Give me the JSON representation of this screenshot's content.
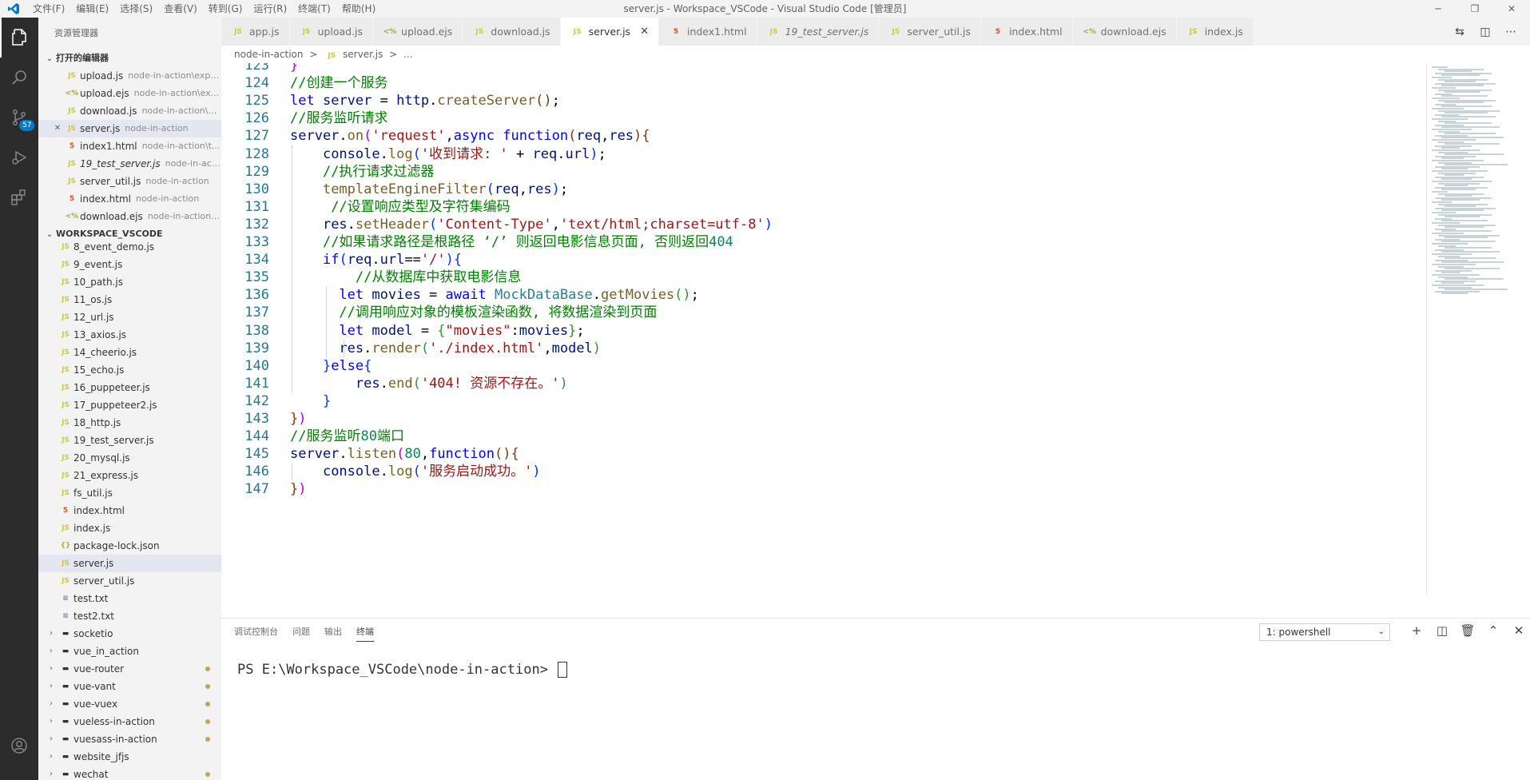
{
  "titlebar": {
    "menu": [
      "文件(F)",
      "编辑(E)",
      "选择(S)",
      "查看(V)",
      "转到(G)",
      "运行(R)",
      "终端(T)",
      "帮助(H)"
    ],
    "title": "server.js - Workspace_VSCode - Visual Studio Code [管理员]"
  },
  "activity": {
    "scm_badge": "57"
  },
  "sidebar": {
    "header": "资源管理器",
    "open_editors_title": "打开的编辑器",
    "open_editors": [
      {
        "icon": "JS",
        "kind": "js",
        "name": "upload.js",
        "desc": "node-in-action\\expr...",
        "close": "",
        "sel": false
      },
      {
        "icon": "<%",
        "kind": "ejs",
        "name": "upload.ejs",
        "desc": "node-in-action\\ex...",
        "close": "",
        "sel": false
      },
      {
        "icon": "JS",
        "kind": "js",
        "name": "download.js",
        "desc": "node-in-action\\e...",
        "close": "",
        "sel": false
      },
      {
        "icon": "JS",
        "kind": "js",
        "name": "server.js",
        "desc": "node-in-action",
        "close": "✕",
        "sel": true
      },
      {
        "icon": "5",
        "kind": "html",
        "name": "index1.html",
        "desc": "node-in-action\\t...",
        "close": "",
        "sel": false
      },
      {
        "icon": "JS",
        "kind": "js",
        "name": "19_test_server.js",
        "desc": "node-in-action",
        "close": "",
        "sel": false
      },
      {
        "icon": "JS",
        "kind": "js",
        "name": "server_util.js",
        "desc": "node-in-action",
        "close": "",
        "sel": false
      },
      {
        "icon": "5",
        "kind": "html",
        "name": "index.html",
        "desc": "node-in-action",
        "close": "",
        "sel": false
      },
      {
        "icon": "<%",
        "kind": "ejs",
        "name": "download.ejs",
        "desc": "node-in-action\\...",
        "close": "",
        "sel": false
      }
    ],
    "workspace_title": "WORKSPACE_VSCODE",
    "files": [
      {
        "icon": "JS",
        "kind": "js",
        "name": "8_event_demo.js"
      },
      {
        "icon": "JS",
        "kind": "js",
        "name": "9_event.js"
      },
      {
        "icon": "JS",
        "kind": "js",
        "name": "10_path.js"
      },
      {
        "icon": "JS",
        "kind": "js",
        "name": "11_os.js"
      },
      {
        "icon": "JS",
        "kind": "js",
        "name": "12_url.js"
      },
      {
        "icon": "JS",
        "kind": "js",
        "name": "13_axios.js"
      },
      {
        "icon": "JS",
        "kind": "js",
        "name": "14_cheerio.js"
      },
      {
        "icon": "JS",
        "kind": "js",
        "name": "15_echo.js"
      },
      {
        "icon": "JS",
        "kind": "js",
        "name": "16_puppeteer.js"
      },
      {
        "icon": "JS",
        "kind": "js",
        "name": "17_puppeteer2.js"
      },
      {
        "icon": "JS",
        "kind": "js",
        "name": "18_http.js"
      },
      {
        "icon": "JS",
        "kind": "js",
        "name": "19_test_server.js"
      },
      {
        "icon": "JS",
        "kind": "js",
        "name": "20_mysql.js"
      },
      {
        "icon": "JS",
        "kind": "js",
        "name": "21_express.js"
      },
      {
        "icon": "JS",
        "kind": "js",
        "name": "fs_util.js"
      },
      {
        "icon": "5",
        "kind": "html",
        "name": "index.html"
      },
      {
        "icon": "JS",
        "kind": "js",
        "name": "index.js"
      },
      {
        "icon": "{}",
        "kind": "json",
        "name": "package-lock.json"
      },
      {
        "icon": "JS",
        "kind": "js",
        "name": "server.js",
        "sel": true
      },
      {
        "icon": "JS",
        "kind": "js",
        "name": "server_util.js"
      },
      {
        "icon": "≡",
        "kind": "txt",
        "name": "test.txt"
      },
      {
        "icon": "≡",
        "kind": "txt",
        "name": "test2.txt"
      }
    ],
    "folders": [
      {
        "name": "socketio",
        "dot": false
      },
      {
        "name": "vue_in_action",
        "dot": false
      },
      {
        "name": "vue-router",
        "dot": true
      },
      {
        "name": "vue-vant",
        "dot": true
      },
      {
        "name": "vue-vuex",
        "dot": true
      },
      {
        "name": "vueless-in-action",
        "dot": true
      },
      {
        "name": "vuesass-in-action",
        "dot": true
      },
      {
        "name": "website_jfjs",
        "dot": false
      },
      {
        "name": "wechat",
        "dot": true
      }
    ]
  },
  "tabs": [
    {
      "icon": "JS",
      "kind": "js",
      "label": "app.js",
      "active": false,
      "italic": false
    },
    {
      "icon": "JS",
      "kind": "js",
      "label": "upload.js",
      "active": false,
      "italic": false
    },
    {
      "icon": "<%",
      "kind": "ejs",
      "label": "upload.ejs",
      "active": false,
      "italic": false
    },
    {
      "icon": "JS",
      "kind": "js",
      "label": "download.js",
      "active": false,
      "italic": false
    },
    {
      "icon": "JS",
      "kind": "js",
      "label": "server.js",
      "active": true,
      "italic": false
    },
    {
      "icon": "5",
      "kind": "html",
      "label": "index1.html",
      "active": false,
      "italic": false
    },
    {
      "icon": "JS",
      "kind": "js",
      "label": "19_test_server.js",
      "active": false,
      "italic": true
    },
    {
      "icon": "JS",
      "kind": "js",
      "label": "server_util.js",
      "active": false,
      "italic": false
    },
    {
      "icon": "5",
      "kind": "html",
      "label": "index.html",
      "active": false,
      "italic": false
    },
    {
      "icon": "<%",
      "kind": "ejs",
      "label": "download.ejs",
      "active": false,
      "italic": false
    },
    {
      "icon": "JS",
      "kind": "js",
      "label": "index.js",
      "active": false,
      "italic": false
    }
  ],
  "breadcrumb": {
    "folder": "node-in-action",
    "sep": ">",
    "icon": "JS",
    "file": "server.js",
    "more": "..."
  },
  "code": {
    "lines": [
      {
        "n": "123",
        "html": "<span class=\"br4\">}</span>"
      },
      {
        "n": "124",
        "html": "<span class=\"cm\">//创建一个服务</span>"
      },
      {
        "n": "125",
        "html": "<span class=\"kw\">let</span> <span class=\"vr\">server</span> = <span class=\"vr\">http</span>.<span class=\"fn\">createServer</span><span class=\"br3\">()</span>;"
      },
      {
        "n": "126",
        "html": "<span class=\"cm\">//服务监听请求</span>"
      },
      {
        "n": "127",
        "html": "<span class=\"vr\">server</span>.<span class=\"fn\">on</span><span class=\"br4\">(</span><span class=\"st\">'request'</span>,<span class=\"kw\">async</span> <span class=\"kw\">function</span><span class=\"br3\">(</span><span class=\"vr\">req</span>,<span class=\"vr\">res</span><span class=\"br3\">)</span><span class=\"br3\">{</span>"
      },
      {
        "n": "128",
        "html": "    <span class=\"vr\">console</span>.<span class=\"fn\">log</span><span class=\"br1\">(</span><span class=\"st\">'收到请求: '</span> + <span class=\"vr\">req</span>.<span class=\"vr\">url</span><span class=\"br1\">)</span>;"
      },
      {
        "n": "129",
        "html": "    <span class=\"cm\">//执行请求过滤器</span>"
      },
      {
        "n": "130",
        "html": "    <span class=\"fn\">templateEngineFilter</span><span class=\"br1\">(</span><span class=\"vr\">req</span>,<span class=\"vr\">res</span><span class=\"br1\">)</span>;"
      },
      {
        "n": "131",
        "html": "     <span class=\"cm\">//设置响应类型及字符集编码</span>"
      },
      {
        "n": "132",
        "html": "    <span class=\"vr\">res</span>.<span class=\"fn\">setHeader</span><span class=\"br1\">(</span><span class=\"st\">'Content-Type'</span>,<span class=\"st\">'text/html;charset=utf-8'</span><span class=\"br1\">)</span>"
      },
      {
        "n": "133",
        "html": "    <span class=\"cm\">//如果请求路径是根路径 ‘/’ 则返回电影信息页面, 否则返回</span><span class=\"nm\">404</span>"
      },
      {
        "n": "134",
        "html": "    <span class=\"kw\">if</span><span class=\"br1\">(</span><span class=\"vr\">req</span>.<span class=\"vr\">url</span>==<span class=\"st\">'/'</span><span class=\"br1\">)</span><span class=\"br1\">{</span>"
      },
      {
        "n": "135",
        "html": "        <span class=\"cm\">//从数据库中获取电影信息</span>"
      },
      {
        "n": "136",
        "html": "      <span class=\"kw\">let</span> <span class=\"vr\">movies</span> = <span class=\"kw\">await</span> <span class=\"cl\">MockDataBase</span>.<span class=\"fn\">getMovies</span><span class=\"br2\">()</span>;"
      },
      {
        "n": "137",
        "html": "      <span class=\"cm\">//调用响应对象的模板渲染函数, 将数据渲染到页面</span>"
      },
      {
        "n": "138",
        "html": "      <span class=\"kw\">let</span> <span class=\"vr\">model</span> = <span class=\"br2\">{</span><span class=\"st\">\"movies\"</span>:<span class=\"vr\">movies</span><span class=\"br2\">}</span>;"
      },
      {
        "n": "139",
        "html": "      <span class=\"vr\">res</span>.<span class=\"fn\">render</span><span class=\"br2\">(</span><span class=\"st\">'./index.html'</span>,<span class=\"vr\">model</span><span class=\"br2\">)</span>"
      },
      {
        "n": "140",
        "html": "    <span class=\"br1\">}</span><span class=\"kw\">else</span><span class=\"br1\">{</span>"
      },
      {
        "n": "141",
        "html": "        <span class=\"vr\">res</span>.<span class=\"fn\">end</span><span class=\"br2\">(</span><span class=\"st\">'404! 资源不存在。'</span><span class=\"br2\">)</span>"
      },
      {
        "n": "142",
        "html": "    <span class=\"br1\">}</span>"
      },
      {
        "n": "143",
        "html": "<span class=\"br3\">}</span><span class=\"br4\">)</span>"
      },
      {
        "n": "144",
        "html": "<span class=\"cm\">//服务监听</span><span class=\"nm\">80</span><span class=\"cm\">端口</span>"
      },
      {
        "n": "145",
        "html": "<span class=\"vr\">server</span>.<span class=\"fn\">listen</span><span class=\"br4\">(</span><span class=\"nm\">80</span>,<span class=\"kw\">function</span><span class=\"br3\">()</span><span class=\"br3\">{</span>"
      },
      {
        "n": "146",
        "html": "    <span class=\"vr\">console</span>.<span class=\"fn\">log</span><span class=\"br1\">(</span><span class=\"st\">'服务启动成功。'</span><span class=\"br1\">)</span>"
      },
      {
        "n": "147",
        "html": "<span class=\"br3\">}</span><span class=\"br4\">)</span>"
      }
    ]
  },
  "panel": {
    "tabs": [
      {
        "label": "调试控制台",
        "active": false
      },
      {
        "label": "问题",
        "active": false
      },
      {
        "label": "输出",
        "active": false
      },
      {
        "label": "终端",
        "active": true
      }
    ],
    "terminal_select": "1: powershell",
    "prompt": "PS E:\\Workspace_VSCode\\node-in-action> "
  }
}
